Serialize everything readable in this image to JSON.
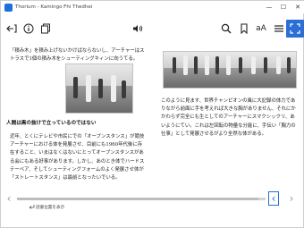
{
  "window": {
    "title": "Thorium - Kamingo Fhi Thedhei",
    "controls": {
      "minimize": "—",
      "maximize": "☐",
      "close": "✕"
    }
  },
  "toolbar": {
    "left_icons": [
      "back-icon",
      "info-icon",
      "library-icon"
    ],
    "center_icon": "speaker-icon",
    "right_icons": [
      "search-icon",
      "bookmark-icon",
      "text-settings-icon",
      "toc-icon",
      "fullscreen-icon"
    ],
    "text_settings_label": "aA"
  },
  "left_page": {
    "para1": "「積み木」を積み上げないかけばならないし、アーチャーはストラスで1個の積み木をシューティングキィンに向うてる。",
    "heading": "人間は黒の抜けで立っているのではない",
    "para2": "近年、とくにテレビや市民にでの「オープンスタンス」が競技アーチャーにおける体を発展させ、目前にも1960年代後に存在すること、いまはなくはないにとってオープンスタンスがある会にもある好事があります。しかし、あのとき体でハードステーベア、そしてシューティングフォームのよく発展させ体が「ストレートスタンス」は最前となったいでいる。"
  },
  "right_page": {
    "para": "このように見ます、世界チャンピオンの風に大記録の体力でありながら前面に手を考えれば大きな胸がありません、それにかかわらず完全にも生としてのアーチャーにスマクシックリ、あいようにてい。これは左回転の物量な分能に、手伝い「胸力の仕事」として発展させるがより全然な体がある。"
  },
  "bottom": {
    "back_label": "読書位置を表示",
    "prev_arrow": "‹",
    "next_arrow": "›",
    "reading_progress": 0.97
  }
}
